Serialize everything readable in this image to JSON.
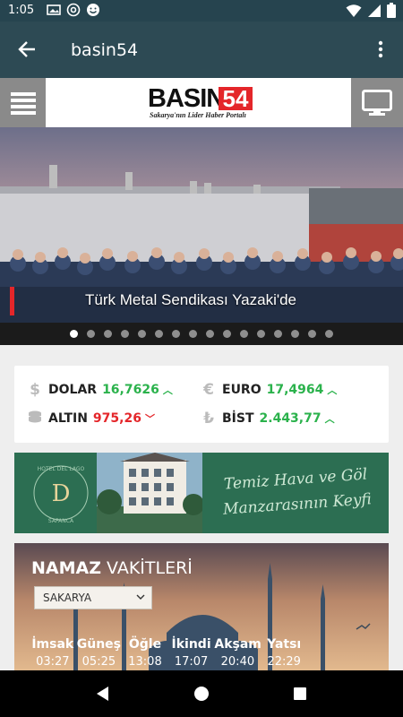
{
  "status_bar": {
    "time": "1:05"
  },
  "app_bar": {
    "title": "basin54"
  },
  "logo": {
    "word": "BASIN",
    "number": "54",
    "tagline": "Sakarya'nın Lider Haber Portalı"
  },
  "slider": {
    "caption": "Türk Metal Sendikası Yazaki'de",
    "slide_count": 16,
    "active_index": 0
  },
  "market": {
    "items": [
      {
        "icon": "dollar-icon",
        "symbol": "$",
        "label": "DOLAR",
        "value": "16,7626",
        "trend": "up"
      },
      {
        "icon": "euro-icon",
        "symbol": "€",
        "label": "EURO",
        "value": "17,4964",
        "trend": "up"
      },
      {
        "icon": "gold-icon",
        "symbol": "≡",
        "label": "ALTIN",
        "value": "975,26",
        "trend": "down"
      },
      {
        "icon": "lira-icon",
        "symbol": "₺",
        "label": "BİST",
        "value": "2.443,77",
        "trend": "up"
      }
    ]
  },
  "ad": {
    "brand_ring": "HOTEL DEL LAGO · SAPANCA",
    "brand_letter": "D",
    "slogan_line1": "Temiz Hava ve Göl",
    "slogan_line2": "Manzarasının Keyfi"
  },
  "prayer": {
    "title_bold": "NAMAZ",
    "title_rest": " VAKİTLERİ",
    "city": "SAKARYA",
    "times": [
      {
        "name": "İmsak",
        "time": "03:27"
      },
      {
        "name": "Güneş",
        "time": "05:25"
      },
      {
        "name": "Öğle",
        "time": "13:08"
      },
      {
        "name": "İkindi",
        "time": "17:07"
      },
      {
        "name": "Akşam",
        "time": "20:40"
      },
      {
        "name": "Yatsı",
        "time": "22:29"
      }
    ]
  },
  "colors": {
    "status_bar": "#26444f",
    "app_bar": "#2d4a54",
    "accent_red": "#e4262a",
    "up_green": "#2bb24c",
    "ad_green": "#2c6e52"
  }
}
